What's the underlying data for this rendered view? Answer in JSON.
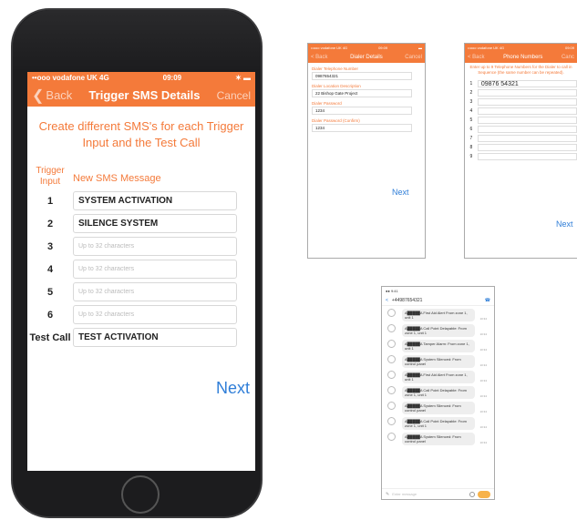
{
  "main": {
    "status": {
      "carrier": "••ooo vodafone UK 4G",
      "time": "09:09",
      "battery": "✶ ▬"
    },
    "nav": {
      "back": "Back",
      "title": "Trigger SMS Details",
      "cancel": "Cancel"
    },
    "intro": "Create different SMS's for each Trigger Input and the Test Call",
    "headers": {
      "trigger": "Trigger Input",
      "message": "New SMS Message"
    },
    "rows": [
      {
        "num": "1",
        "value": "SYSTEM ACTIVATION",
        "placeholder": ""
      },
      {
        "num": "2",
        "value": "SILENCE SYSTEM",
        "placeholder": ""
      },
      {
        "num": "3",
        "value": "",
        "placeholder": "Up to 32 characters"
      },
      {
        "num": "4",
        "value": "",
        "placeholder": "Up to 32 characters"
      },
      {
        "num": "5",
        "value": "",
        "placeholder": "Up to 32 characters"
      },
      {
        "num": "6",
        "value": "",
        "placeholder": "Up to 32 characters"
      },
      {
        "num": "Test Call",
        "value": "TEST ACTIVATION",
        "placeholder": ""
      }
    ],
    "next": "Next"
  },
  "dialer": {
    "status": {
      "carrier": "••ooo vodafone UK 4G",
      "time": "09:09"
    },
    "nav": {
      "back": "< Back",
      "title": "Dialer Details",
      "cancel": "Cancel"
    },
    "fields": [
      {
        "label": "Dialer Telephone Number",
        "value": "0987654321"
      },
      {
        "label": "Dialer Location Description",
        "value": "22 Bishop Gate Project"
      },
      {
        "label": "Dialer Password",
        "value": "1234"
      },
      {
        "label": "Dialer Password (Confirm)",
        "value": "1234"
      }
    ],
    "next": "Next"
  },
  "phones": {
    "status": {
      "carrier": "••ooo vodafone UK 4G",
      "time": "09:09"
    },
    "nav": {
      "back": "< Back",
      "title": "Phone Numbers",
      "cancel": "Canc"
    },
    "intro": "Enter up to 9 Telephone Numbers for the Dialer to call in Sequence (the same number can be repeated).",
    "numbers": [
      "09876 54321",
      "",
      "",
      "",
      "",
      "",
      "",
      "",
      ""
    ],
    "next": "Next"
  },
  "messages": {
    "status": "●● 9:41",
    "contact": "+44987654321",
    "bubbles": [
      {
        "text": "A█████A First Aid Alert From zone 1, unit 1",
        "time": "10:34"
      },
      {
        "text": "A█████A Call Point Delayable: From zone 1, unit 1",
        "time": "10:34"
      },
      {
        "text": "A█████A Tamper Alarm: From zone 1, unit 1",
        "time": "10:34"
      },
      {
        "text": "A█████A System Silenced: From control panel",
        "time": "10:34"
      },
      {
        "text": "A█████A First Aid Alert From zone 1, unit 1",
        "time": "10:34"
      },
      {
        "text": "A█████A Call Point Delayable: From zone 1, unit 1",
        "time": "10:34"
      },
      {
        "text": "A█████A System Silenced: From control panel",
        "time": "10:34"
      },
      {
        "text": "A█████A Call Point Delayable: From zone 1, unit 1",
        "time": "10:34"
      },
      {
        "text": "A█████A System Silenced: From control panel",
        "time": "10:34"
      }
    ],
    "input_placeholder": "Enter message"
  }
}
